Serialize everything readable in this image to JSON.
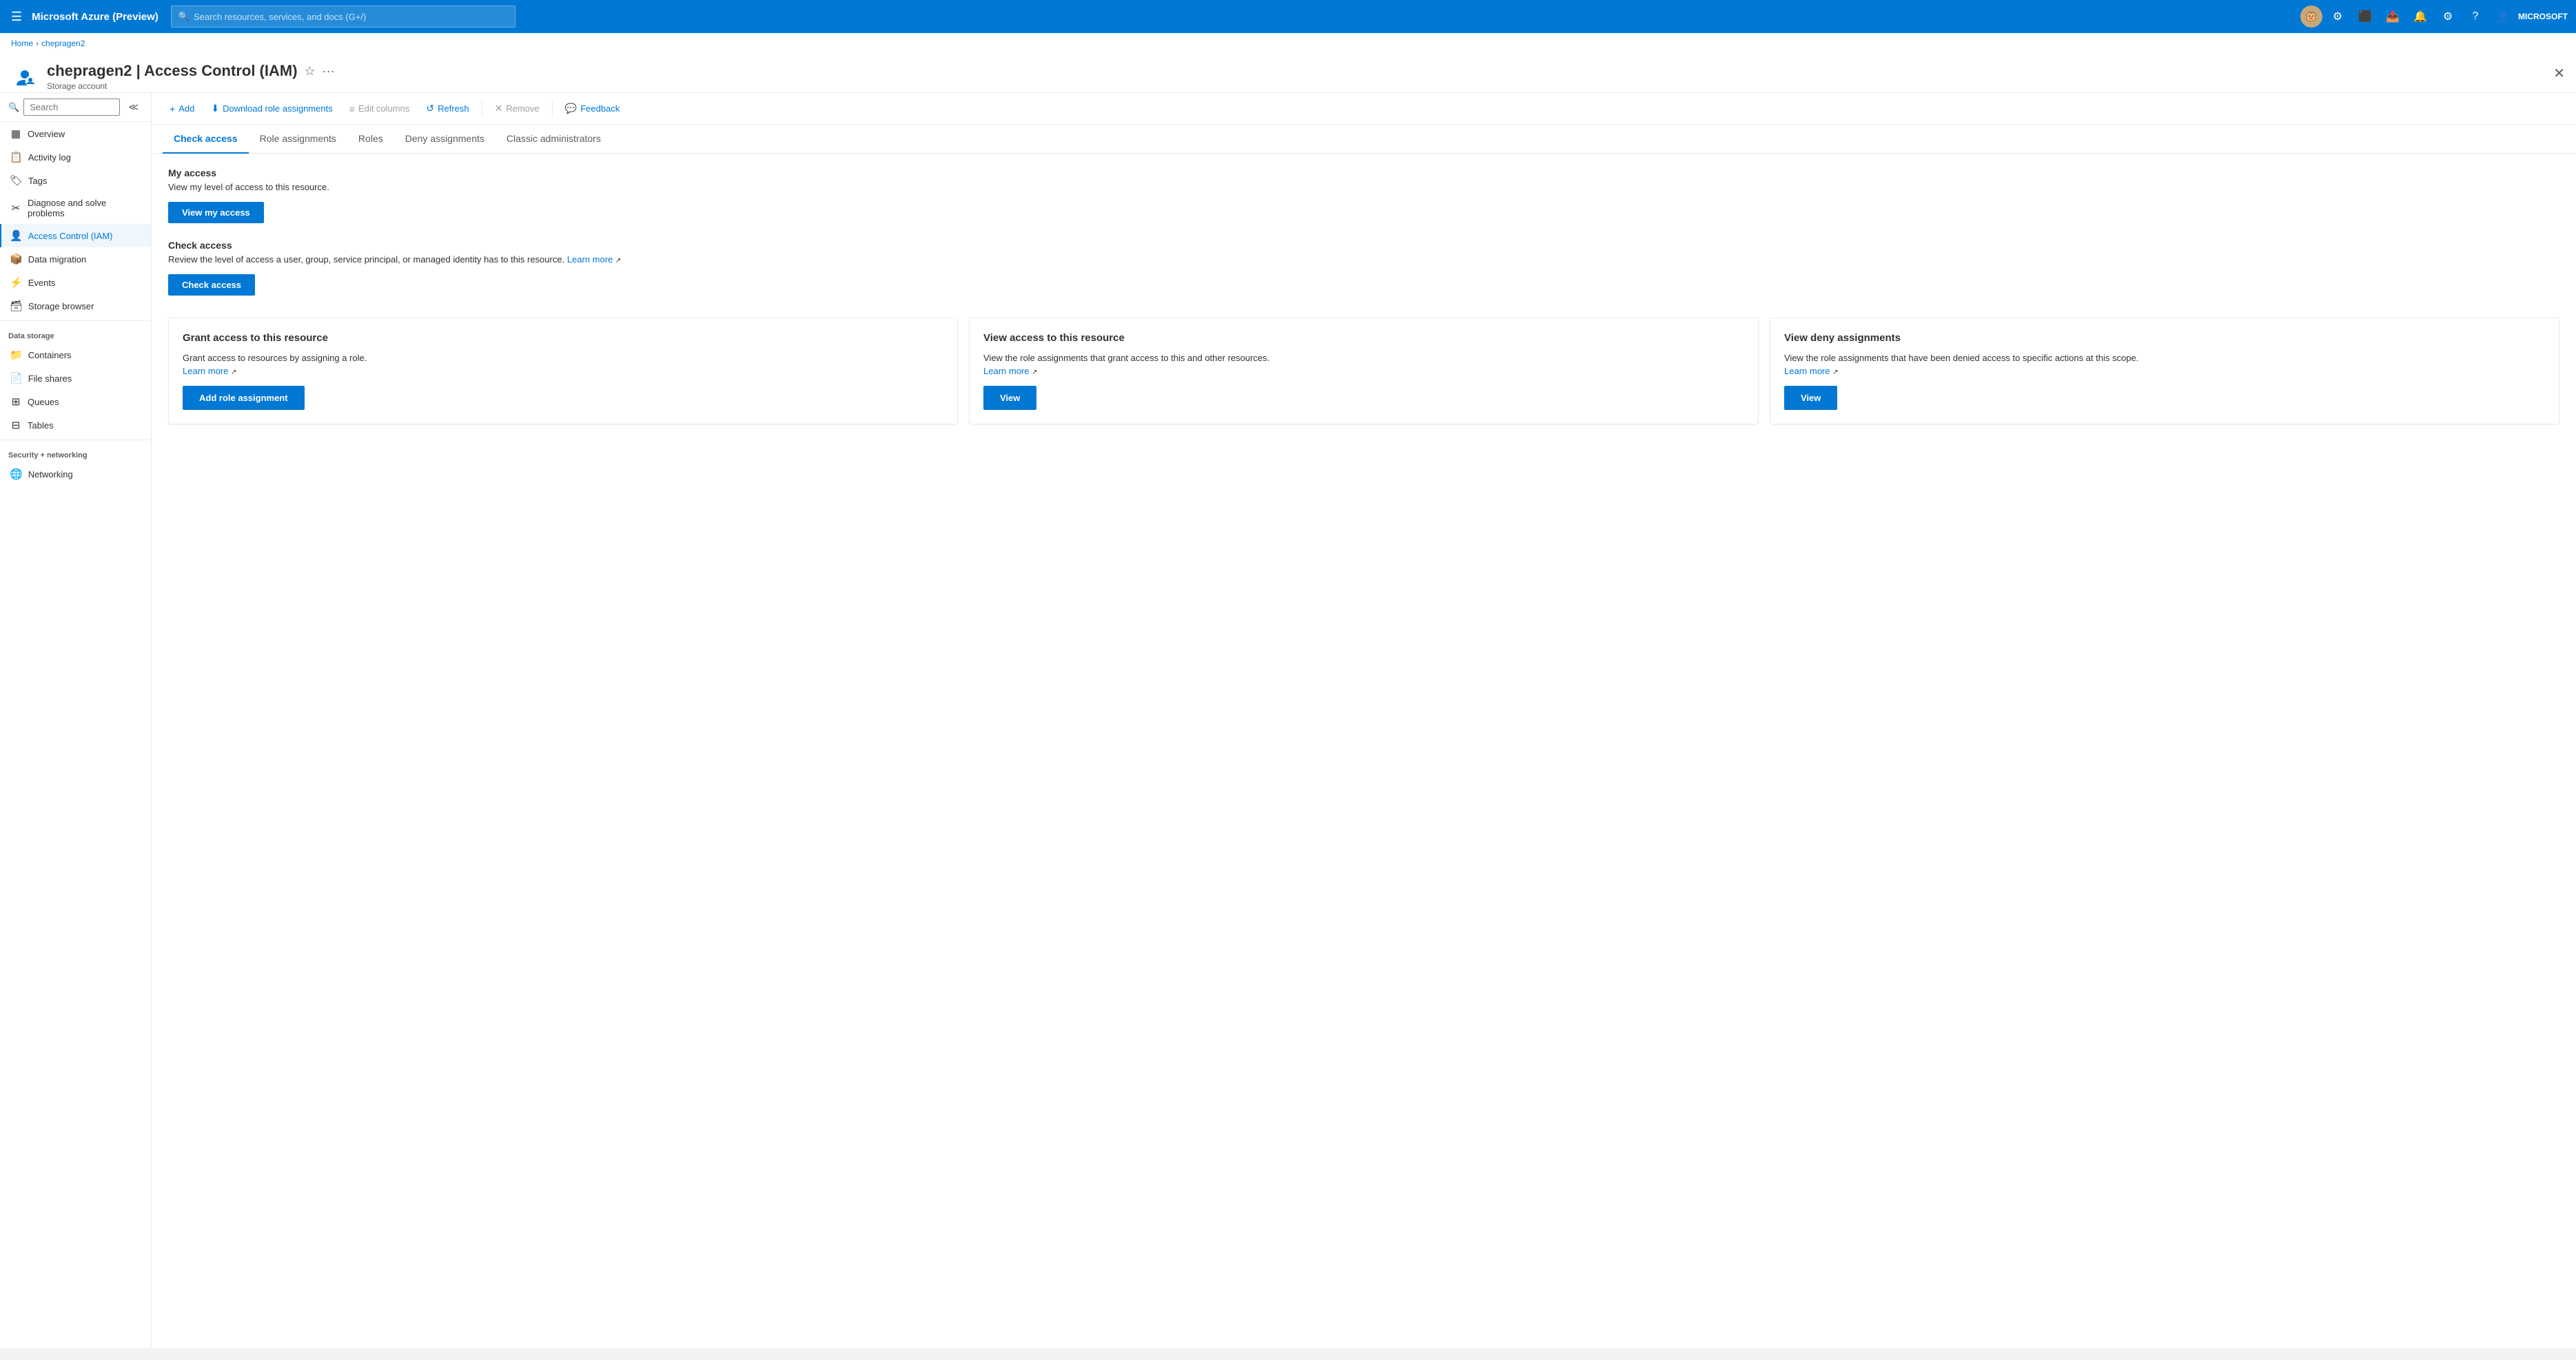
{
  "topnav": {
    "logo": "Microsoft Azure (Preview)",
    "search_placeholder": "Search resources, services, and docs (G+/)",
    "user_label": "MICROSOFT",
    "hamburger_icon": "☰",
    "search_icon": "🔍",
    "avatar_emoji": "🐵"
  },
  "breadcrumb": {
    "home": "Home",
    "current": "chepragen2"
  },
  "header": {
    "title": "chepragen2 | Access Control (IAM)",
    "subtitle": "Storage account",
    "star_icon": "☆",
    "more_icon": "···",
    "close_icon": "✕"
  },
  "sidebar": {
    "search_placeholder": "Search",
    "items": [
      {
        "id": "overview",
        "label": "Overview",
        "icon": "▦",
        "active": false
      },
      {
        "id": "activity-log",
        "label": "Activity log",
        "icon": "📋",
        "active": false
      },
      {
        "id": "tags",
        "label": "Tags",
        "icon": "🏷",
        "active": false
      },
      {
        "id": "diagnose",
        "label": "Diagnose and solve problems",
        "icon": "✂",
        "active": false
      },
      {
        "id": "access-control",
        "label": "Access Control (IAM)",
        "icon": "👤",
        "active": true
      },
      {
        "id": "data-migration",
        "label": "Data migration",
        "icon": "📦",
        "active": false
      },
      {
        "id": "events",
        "label": "Events",
        "icon": "⚡",
        "active": false
      },
      {
        "id": "storage-browser",
        "label": "Storage browser",
        "icon": "🗃",
        "active": false
      }
    ],
    "data_storage_label": "Data storage",
    "data_storage_items": [
      {
        "id": "containers",
        "label": "Containers",
        "icon": "📁"
      },
      {
        "id": "file-shares",
        "label": "File shares",
        "icon": "📄"
      },
      {
        "id": "queues",
        "label": "Queues",
        "icon": "⊞"
      },
      {
        "id": "tables",
        "label": "Tables",
        "icon": "⊟"
      }
    ],
    "security_label": "Security + networking",
    "security_items": [
      {
        "id": "networking",
        "label": "Networking",
        "icon": "🌐"
      }
    ]
  },
  "toolbar": {
    "add_label": "Add",
    "download_label": "Download role assignments",
    "edit_columns_label": "Edit columns",
    "refresh_label": "Refresh",
    "remove_label": "Remove",
    "feedback_label": "Feedback",
    "add_icon": "+",
    "download_icon": "⬇",
    "edit_icon": "≡",
    "refresh_icon": "↺",
    "remove_icon": "✕",
    "feedback_icon": "💬"
  },
  "tabs": [
    {
      "id": "check-access",
      "label": "Check access",
      "active": true
    },
    {
      "id": "role-assignments",
      "label": "Role assignments",
      "active": false
    },
    {
      "id": "roles",
      "label": "Roles",
      "active": false
    },
    {
      "id": "deny-assignments",
      "label": "Deny assignments",
      "active": false
    },
    {
      "id": "classic-administrators",
      "label": "Classic administrators",
      "active": false
    }
  ],
  "check_access": {
    "my_access": {
      "title": "My access",
      "description": "View my level of access to this resource.",
      "button_label": "View my access"
    },
    "check_access": {
      "title": "Check access",
      "description": "Review the level of access a user, group, service principal, or managed identity has to this resource.",
      "learn_more": "Learn more",
      "button_label": "Check access"
    },
    "cards": [
      {
        "id": "grant-access",
        "title": "Grant access to this resource",
        "description": "Grant access to resources by assigning a role.",
        "learn_more": "Learn more",
        "button_label": "Add role assignment"
      },
      {
        "id": "view-access",
        "title": "View access to this resource",
        "description": "View the role assignments that grant access to this and other resources.",
        "learn_more": "Learn more",
        "button_label": "View"
      },
      {
        "id": "view-deny",
        "title": "View deny assignments",
        "description": "View the role assignments that have been denied access to specific actions at this scope.",
        "learn_more": "Learn more",
        "button_label": "View"
      }
    ]
  }
}
